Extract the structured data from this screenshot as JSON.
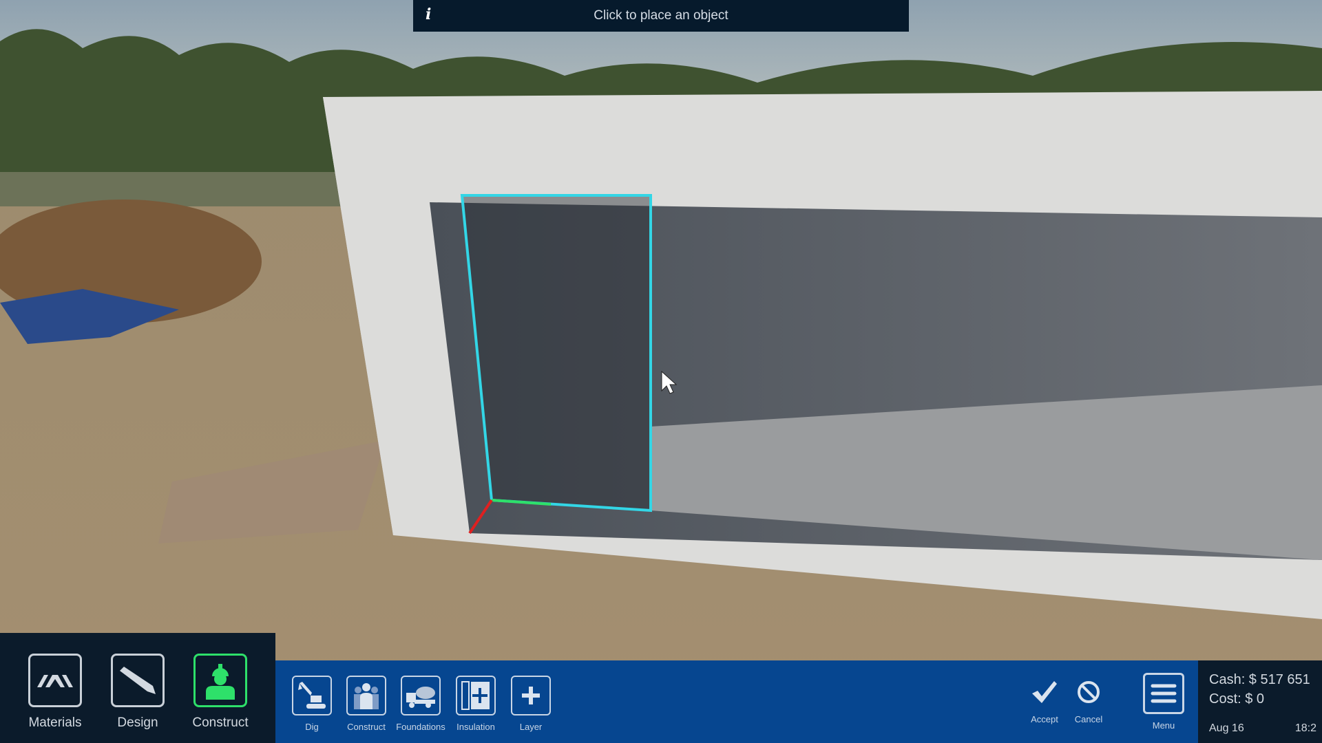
{
  "banner": {
    "icon": "info-icon",
    "text": "Click to place an object"
  },
  "modes": [
    {
      "label": "Materials",
      "icon": "materials-icon",
      "active": false
    },
    {
      "label": "Design",
      "icon": "pencil-icon",
      "active": false
    },
    {
      "label": "Construct",
      "icon": "worker-icon",
      "active": true
    }
  ],
  "tools": [
    {
      "label": "Dig",
      "icon": "excavator-icon"
    },
    {
      "label": "Construct",
      "icon": "workers-icon"
    },
    {
      "label": "Foundations",
      "icon": "cement-truck-icon"
    },
    {
      "label": "Insulation",
      "icon": "insulation-icon"
    },
    {
      "label": "Layer",
      "icon": "plus-icon"
    }
  ],
  "actions": {
    "accept": "Accept",
    "cancel": "Cancel",
    "menu": "Menu"
  },
  "status": {
    "cash": "Cash: $ 517 651",
    "cost": "Cost: $ 0",
    "date": "Aug 16",
    "time": "18:2"
  },
  "colors": {
    "active": "#2ee06a",
    "toolbar": "#064690",
    "panel": "#0b1b2b",
    "selection": "#33d6e6"
  }
}
